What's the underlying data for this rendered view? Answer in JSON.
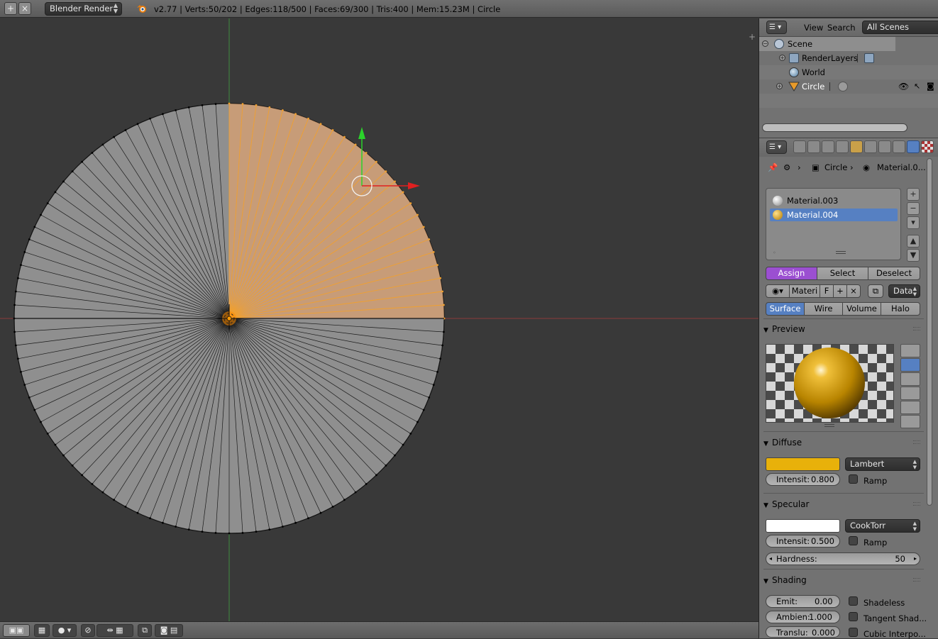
{
  "topbar": {
    "engine": "Blender Render",
    "stats": "v2.77 | Verts:50/202 | Edges:118/500 | Faces:69/300 | Tris:400 | Mem:15.23M | Circle"
  },
  "outliner": {
    "menu_view": "View",
    "menu_search": "Search",
    "scenes_select": "All Scenes",
    "items": [
      {
        "label": "Scene",
        "icon": "scene-icon"
      },
      {
        "label": "RenderLayers",
        "icon": "render-layers-icon"
      },
      {
        "label": "World",
        "icon": "world-icon"
      },
      {
        "label": "Circle",
        "icon": "mesh-object-icon"
      }
    ]
  },
  "properties": {
    "breadcrumb": {
      "object": "Circle",
      "material": "Material.0..."
    },
    "material_slots": [
      "Material.003",
      "Material.004"
    ],
    "assign_label": "Assign",
    "select_label": "Select",
    "deselect_label": "Deselect",
    "material_name_short": "Materi",
    "fake_user": "F",
    "link_select": "Data",
    "tabs": [
      "Surface",
      "Wire",
      "Volume",
      "Halo"
    ],
    "preview_title": "Preview",
    "diffuse": {
      "title": "Diffuse",
      "color": "#e8b10a",
      "shader": "Lambert",
      "intensity_label": "Intensit:",
      "intensity": "0.800",
      "ramp": "Ramp"
    },
    "specular": {
      "title": "Specular",
      "color": "#ffffff",
      "shader": "CookTorr",
      "intensity_label": "Intensit:",
      "intensity": "0.500",
      "ramp": "Ramp",
      "hardness_label": "Hardness:",
      "hardness": "50"
    },
    "shading": {
      "title": "Shading",
      "emit_label": "Emit:",
      "emit": "0.00",
      "ambient_label": "Ambien:",
      "ambient": "1.000",
      "translucency_label": "Translu:",
      "translucency": "0.000",
      "shadeless": "Shadeless",
      "tangent": "Tangent Shad...",
      "cubic": "Cubic Interpo..."
    }
  },
  "colors": {
    "selection_orange": "#f0a030",
    "active_blue": "#5680c2",
    "assign_purple": "#9b4fd1"
  }
}
